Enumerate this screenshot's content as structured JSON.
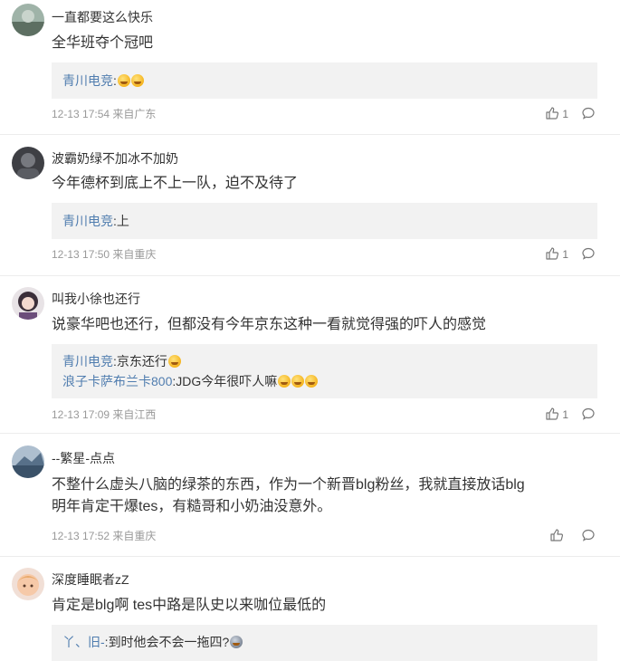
{
  "comments": [
    {
      "username": "一直都要这么快乐",
      "text": "全华班夺个冠吧",
      "replies": [
        {
          "name": "青川电竞",
          "sep": ":",
          "text": "",
          "emojis": [
            "thinking-emoji",
            "thinking-emoji"
          ]
        }
      ],
      "time": "12-13 17:54",
      "source": "来自广东",
      "likes": "1"
    },
    {
      "username": "波霸奶绿不加冰不加奶",
      "text": "今年德杯到底上不上一队，迫不及待了",
      "replies": [
        {
          "name": "青川电竞",
          "sep": ":",
          "text": "上",
          "emojis": []
        }
      ],
      "time": "12-13 17:50",
      "source": "来自重庆",
      "likes": "1"
    },
    {
      "username": "叫我小徐也还行",
      "text": "说豪华吧也还行，但都没有今年京东这种一看就觉得强的吓人的感觉",
      "replies": [
        {
          "name": "青川电竞",
          "sep": ":",
          "text": "京东还行",
          "emojis": [
            "grin-emoji"
          ]
        },
        {
          "name": "浪子卡萨布兰卡800",
          "sep": ":",
          "text": "JDG今年很吓人嘛",
          "emojis": [
            "laugh-emoji",
            "laugh-emoji",
            "laugh-emoji"
          ]
        }
      ],
      "time": "12-13 17:09",
      "source": "来自江西",
      "likes": "1"
    },
    {
      "username": "--繁星-点点",
      "text_lines": [
        "不整什么虚头八脑的绿茶的东西，作为一个新晋blg粉丝，我就直接放话blg",
        "明年肯定干爆tes，有糙哥和小奶油没意外。"
      ],
      "time": "12-13 17:52",
      "source": "来自重庆",
      "likes": ""
    },
    {
      "username": "深度睡眠者zZ",
      "text": "肯定是blg啊 tes中路是队史以来咖位最低的",
      "replies": [
        {
          "name": "丫、旧-",
          "sep": ":",
          "text": "到时他会不会一拖四?",
          "emojis": [
            "shrug-emoji"
          ]
        }
      ]
    }
  ],
  "colors": {
    "reply_name": "#507daf",
    "meta": "#999999",
    "reply_bg": "#f2f2f2"
  }
}
